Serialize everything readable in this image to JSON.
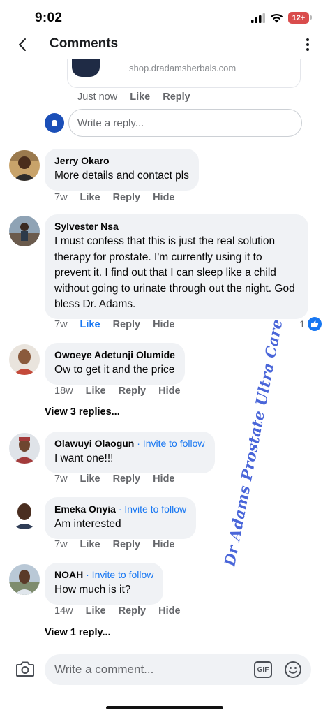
{
  "status_bar": {
    "time": "9:02",
    "battery": "12+"
  },
  "header": {
    "title": "Comments"
  },
  "partial_card": {
    "url": "shop.dradamsherbals.com"
  },
  "top_actions": {
    "time": "Just now",
    "like": "Like",
    "reply": "Reply"
  },
  "reply_box": {
    "placeholder": "Write a reply..."
  },
  "comments": [
    {
      "name": "Jerry Okaro",
      "text": "More details and contact pls",
      "time": "7w",
      "like": "Like",
      "reply": "Reply",
      "hide": "Hide"
    },
    {
      "name": "Sylvester Nsa",
      "text": "I must confess that this is just the real solution therapy for prostate. I'm currently using it to prevent it. I find out that I can sleep like a child without going to urinate through out the night. God bless Dr. Adams.",
      "time": "7w",
      "like": "Like",
      "reply": "Reply",
      "hide": "Hide",
      "like_count": "1"
    },
    {
      "name": "Owoeye Adetunji Olumide",
      "text": "Ow to get it and  the price",
      "time": "18w",
      "like": "Like",
      "reply": "Reply",
      "hide": "Hide",
      "view_replies": "View 3 replies..."
    },
    {
      "name": "Olawuyi Olaogun",
      "invite": " · Invite to follow",
      "text": "I want one!!!",
      "time": "7w",
      "like": "Like",
      "reply": "Reply",
      "hide": "Hide"
    },
    {
      "name": "Emeka Onyia",
      "invite": " · Invite to follow",
      "text": "Am interested",
      "time": "7w",
      "like": "Like",
      "reply": "Reply",
      "hide": "Hide"
    },
    {
      "name": "NOAH",
      "invite": " · Invite to follow",
      "text": "How much is it?",
      "time": "14w",
      "like": "Like",
      "reply": "Reply",
      "hide": "Hide",
      "view_replies": "View 1 reply..."
    }
  ],
  "watermark": "Dr Adams Prostate Ultra Care",
  "composer": {
    "placeholder": "Write a comment...",
    "gif": "GIF"
  },
  "colors": {
    "accent": "#1877f2",
    "bubble": "#f0f2f5",
    "watermark": "#4a66d9"
  }
}
